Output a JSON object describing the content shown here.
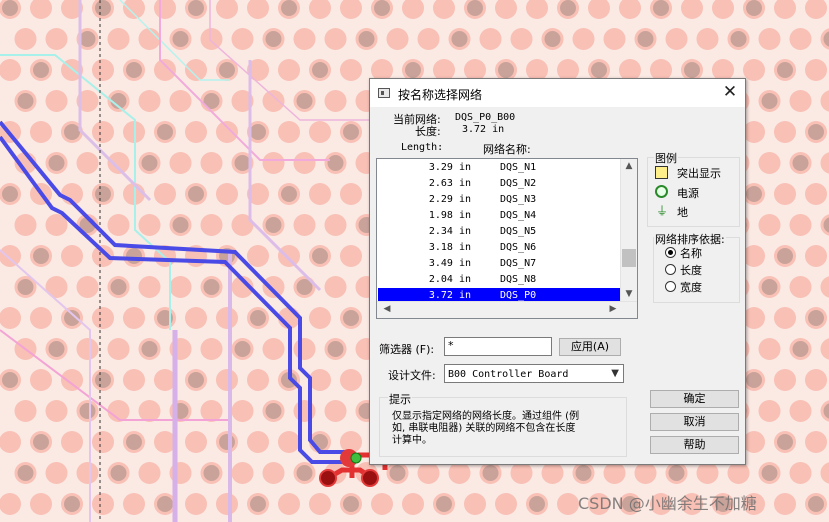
{
  "dialog": {
    "title": "按名称选择网络",
    "current_net_label": "当前网络:",
    "current_net_value": "DQS_P0_B00",
    "length_label": "长度:",
    "length_value": "3.72 in",
    "col_length": "Length:",
    "col_name": "网络名称:",
    "rows": [
      {
        "len": "3.29 in",
        "name": "DQS_N1"
      },
      {
        "len": "2.63 in",
        "name": "DQS_N2"
      },
      {
        "len": "2.29 in",
        "name": "DQS_N3"
      },
      {
        "len": "1.98 in",
        "name": "DQS_N4"
      },
      {
        "len": "2.34 in",
        "name": "DQS_N5"
      },
      {
        "len": "3.18 in",
        "name": "DQS_N6"
      },
      {
        "len": "3.49 in",
        "name": "DQS_N7"
      },
      {
        "len": "2.04 in",
        "name": "DQS_N8"
      },
      {
        "len": "3.72 in",
        "name": "DQS_P0"
      }
    ],
    "legend": {
      "title": "图例",
      "items": [
        "突出显示",
        "电源",
        "地"
      ]
    },
    "sort": {
      "title": "网络排序依据:",
      "options": [
        "名称",
        "长度",
        "宽度"
      ],
      "selected": 0
    },
    "filter_label": "筛选器 (F):",
    "filter_value": "*",
    "apply_button": "应用(A)",
    "design_label": "设计文件:",
    "design_value": "B00 Controller Board",
    "hint_title": "提示",
    "hint_text_1": "仅显示指定网络的网络长度。通过组件 (例",
    "hint_text_2": "如, 串联电阻器) 关联的网络不包含在长度",
    "hint_text_3": "计算中。",
    "ok_button": "确定",
    "cancel_button": "取消",
    "help_button": "帮助"
  },
  "watermark": "CSDN @小幽余生不加糖",
  "colors": {
    "selection": "#0000ff",
    "trace_blue": "#4a4ae6",
    "pad_fill": "#c9a39a",
    "pad_ring": "#f9c0b5",
    "background": "#fbe9e3"
  }
}
